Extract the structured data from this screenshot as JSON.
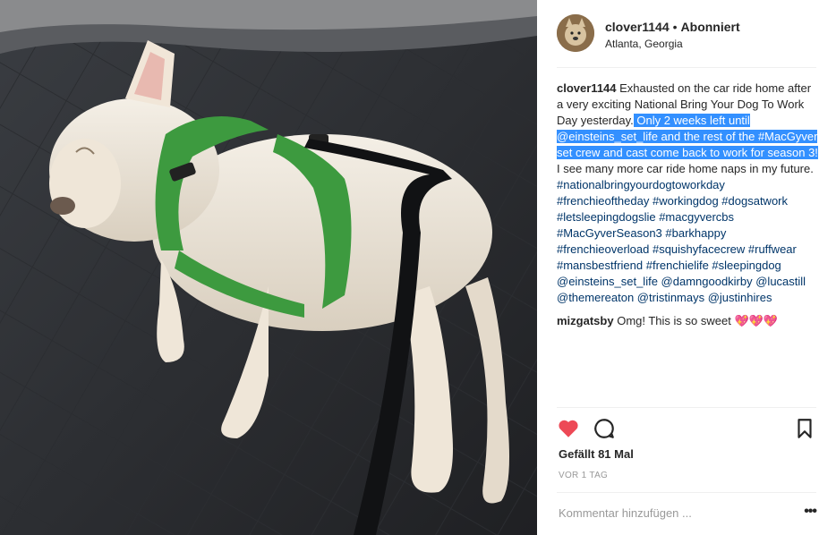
{
  "post": {
    "image_alt": "French bulldog asleep on a car seat cover wearing a green harness",
    "header": {
      "username": "clover1144",
      "separator": "•",
      "follow_status": "Abonniert",
      "location": "Atlanta, Georgia"
    },
    "caption": {
      "username": "clover1144",
      "text_plain_1": "Exhausted on the car ride home after a very exciting National Bring Your Dog To Work Day yesterday.",
      "text_selected": " Only 2 weeks left until @einsteins_set_life and the rest of the #MacGyver set crew and cast come back to work for season 3!",
      "text_plain_2": " I see many more car ride home naps in my future.",
      "hashtags": "#nationalbringyourdogtoworkday #frenchieoftheday #workingdog #dogsatwork #letsleepingdogslie #macgyvercbs #MacGyverSeason3 #barkhappy #frenchieoverload #squishyfacecrew #ruffwear #mansbestfriend #frenchielife #sleepingdog @einsteins_set_life @damngoodkirby @lucastill @themereaton @tristinmays @justinhires"
    },
    "comment": {
      "username": "mizgatsby",
      "text": "Omg! This is so sweet 💖💖💖"
    },
    "likes_text": "Gefällt 81 Mal",
    "timestamp": "VOR 1 TAG",
    "composer_placeholder": "Kommentar hinzufügen ...",
    "more_label": "•••",
    "colors": {
      "like": "#ed4956",
      "link": "#003569",
      "selection": "#3390ff"
    }
  }
}
